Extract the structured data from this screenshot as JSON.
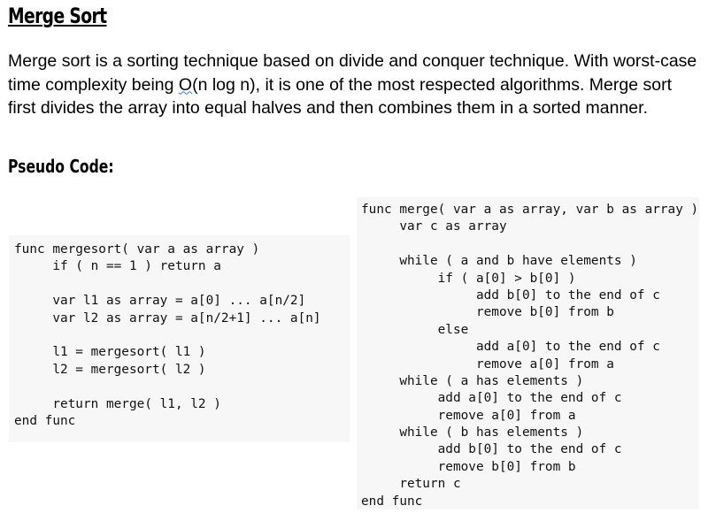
{
  "title": "Merge Sort",
  "intro": {
    "before": "Merge sort is a sorting technique based on divide and conquer technique. With worst-case time complexity being ",
    "squiggle": "O",
    "after": "(n log n), it is one of the most respected algorithms. Merge sort first divides the array into equal halves and then combines them in a sorted manner."
  },
  "subtitle": "Pseudo Code:",
  "code_left": [
    "func mergesort( var a as array )",
    "     if ( n == 1 ) return a",
    "",
    "     var l1 as array = a[0] ... a[n/2]",
    "     var l2 as array = a[n/2+1] ... a[n]",
    "",
    "     l1 = mergesort( l1 )",
    "     l2 = mergesort( l2 )",
    "",
    "     return merge( l1, l2 )",
    "end func"
  ],
  "code_right": [
    "func merge( var a as array, var b as array )",
    "     var c as array",
    "",
    "     while ( a and b have elements )",
    "          if ( a[0] > b[0] )",
    "               add b[0] to the end of c",
    "               remove b[0] from b",
    "          else",
    "               add a[0] to the end of c",
    "               remove a[0] from a",
    "     while ( a has elements )",
    "          add a[0] to the end of c",
    "          remove a[0] from a",
    "     while ( b has elements )",
    "          add b[0] to the end of c",
    "          remove b[0] from b",
    "     return c",
    "end func"
  ]
}
